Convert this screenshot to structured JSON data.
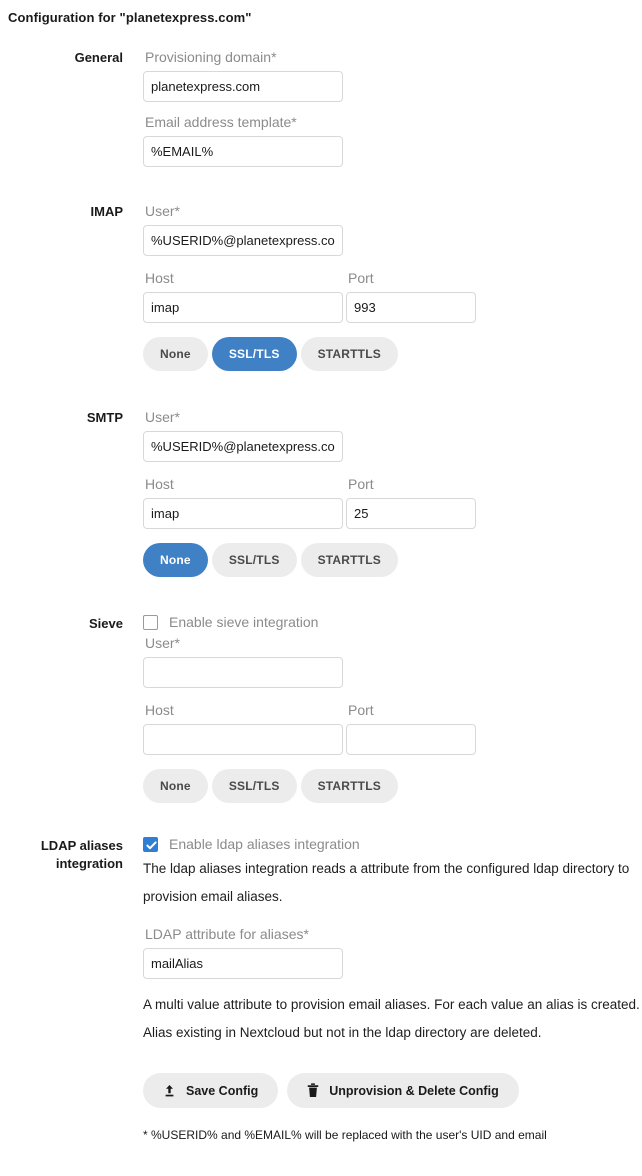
{
  "page": {
    "title": "Configuration for \"planetexpress.com\"",
    "footnote": "* %USERID% and %EMAIL% will be replaced with the user's UID and email"
  },
  "colors": {
    "accent_active": "#4080c4",
    "checkbox_checked": "#2e7fd4",
    "pill_idle_bg": "#ececec",
    "input_border": "#d8d8d8",
    "label_grey": "#8b8b8b"
  },
  "general": {
    "section_label": "General",
    "provisioning_domain": {
      "label": "Provisioning domain*",
      "value": "planetexpress.com",
      "placeholder": ""
    },
    "email_template": {
      "label": "Email address template*",
      "value": "%EMAIL%",
      "placeholder": ""
    }
  },
  "imap": {
    "section_label": "IMAP",
    "user": {
      "label": "User*",
      "value": "%USERID%@planetexpress.com",
      "placeholder": ""
    },
    "host": {
      "label": "Host",
      "value": "imap",
      "placeholder": ""
    },
    "port": {
      "label": "Port",
      "value": "993",
      "placeholder": ""
    },
    "encryption": {
      "options": [
        "None",
        "SSL/TLS",
        "STARTTLS"
      ],
      "selected": "SSL/TLS"
    }
  },
  "smtp": {
    "section_label": "SMTP",
    "user": {
      "label": "User*",
      "value": "%USERID%@planetexpress.com",
      "placeholder": ""
    },
    "host": {
      "label": "Host",
      "value": "imap",
      "placeholder": ""
    },
    "port": {
      "label": "Port",
      "value": "25",
      "placeholder": ""
    },
    "encryption": {
      "options": [
        "None",
        "SSL/TLS",
        "STARTTLS"
      ],
      "selected": "None"
    }
  },
  "sieve": {
    "section_label": "Sieve",
    "enable": {
      "label": "Enable sieve integration",
      "checked": false
    },
    "user": {
      "label": "User*",
      "value": "",
      "placeholder": ""
    },
    "host": {
      "label": "Host",
      "value": "",
      "placeholder": ""
    },
    "port": {
      "label": "Port",
      "value": "",
      "placeholder": ""
    },
    "encryption": {
      "options": [
        "None",
        "SSL/TLS",
        "STARTTLS"
      ],
      "selected": ""
    }
  },
  "ldap_aliases": {
    "section_label_line1": "LDAP aliases",
    "section_label_line2": "integration",
    "enable": {
      "label": "Enable ldap aliases integration",
      "checked": true
    },
    "description": "The ldap aliases integration reads a attribute from the configured ldap directory to provision email aliases.",
    "attribute": {
      "label": "LDAP attribute for aliases*",
      "value": "mailAlias",
      "placeholder": ""
    },
    "attribute_help": "A multi value attribute to provision email aliases. For each value an alias is created. Alias existing in Nextcloud but not in the ldap directory are deleted."
  },
  "actions": {
    "save": {
      "label": "Save Config",
      "icon": "upload-icon"
    },
    "delete": {
      "label": "Unprovision & Delete Config",
      "icon": "trash-icon"
    }
  }
}
